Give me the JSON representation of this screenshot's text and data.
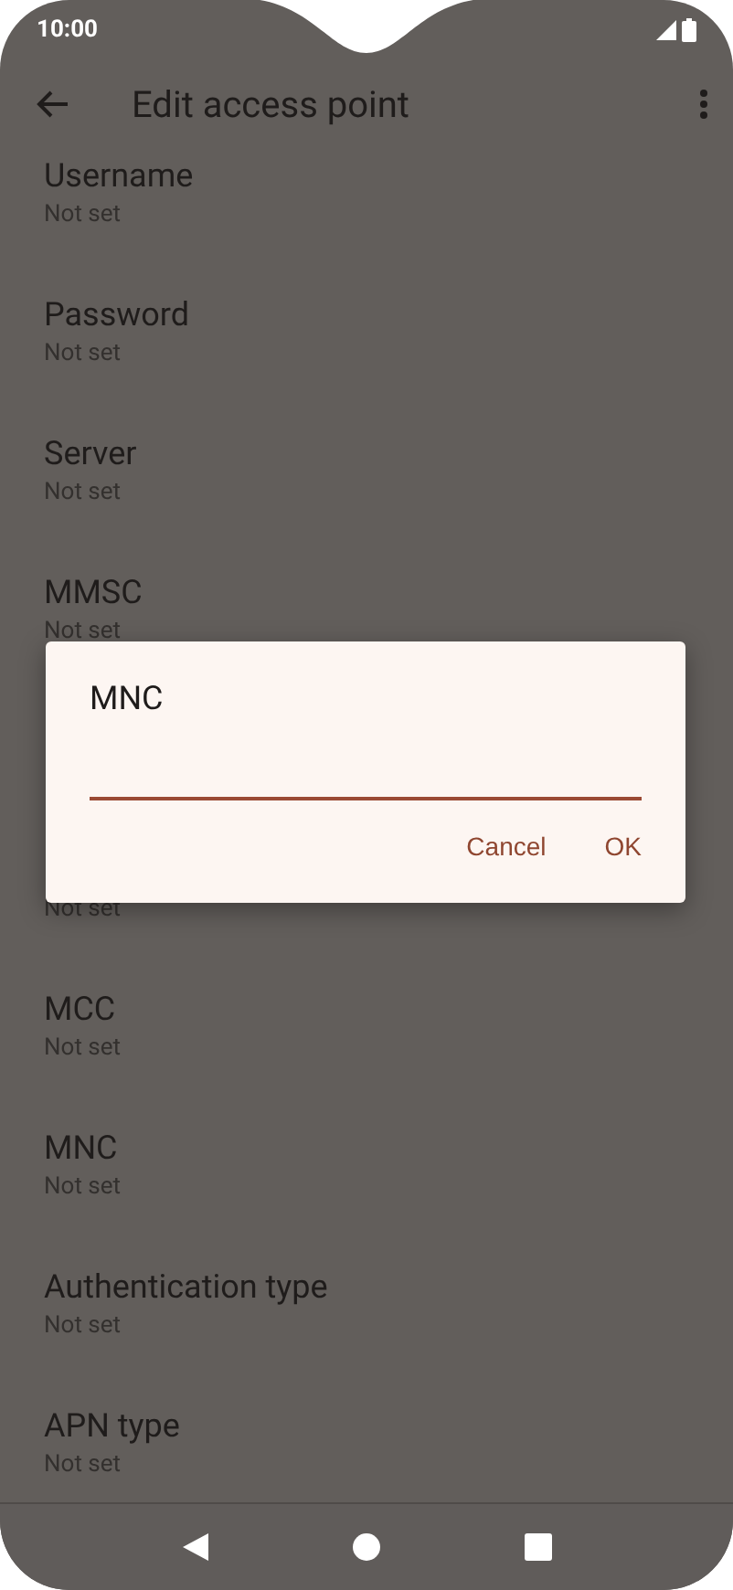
{
  "status_bar": {
    "time": "10:00"
  },
  "app_bar": {
    "title": "Edit access point"
  },
  "settings": {
    "groups": [
      [
        {
          "title": "Username",
          "summary": "Not set"
        },
        {
          "title": "Password",
          "summary": "Not set"
        },
        {
          "title": "Server",
          "summary": "Not set"
        },
        {
          "title": "MMSC",
          "summary": "Not set"
        }
      ],
      [
        {
          "summary": "Not set"
        },
        {
          "title": "MCC",
          "summary": "Not set"
        },
        {
          "title": "MNC",
          "summary": "Not set"
        },
        {
          "title": "Authentication type",
          "summary": "Not set"
        },
        {
          "title": "APN type",
          "summary": "Not set"
        }
      ]
    ]
  },
  "dialog": {
    "title": "MNC",
    "input": {
      "focused": true
    },
    "buttons": [
      "Cancel",
      "OK"
    ]
  }
}
